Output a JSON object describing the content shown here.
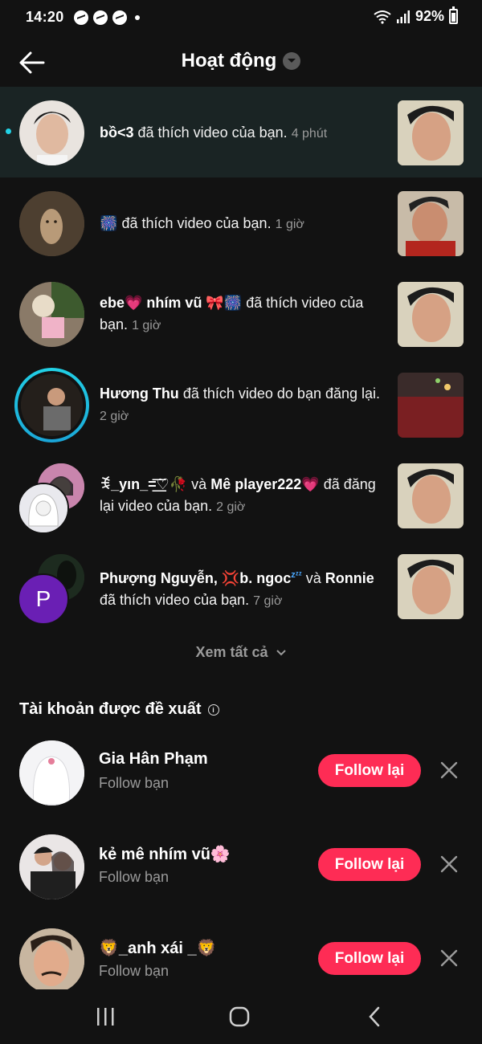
{
  "status_bar": {
    "time": "14:20",
    "battery": "92%"
  },
  "header": {
    "title": "Hoạt động"
  },
  "activities": [
    {
      "name": "bồ<3",
      "action": "đã thích video của bạn.",
      "time": "4 phút",
      "unread": true
    },
    {
      "name": "🎆",
      "action": "đã thích video của bạn.",
      "time": "1 giờ"
    },
    {
      "name": "ebe💗 nhím vũ 🎀🎆",
      "action": "đã thích video của bạn.",
      "time": "1 giờ"
    },
    {
      "name": "Hương Thu",
      "action": "đã thích video do bạn đăng lại.",
      "time": "2 giờ"
    },
    {
      "name": "ꉂ_yın_=͟͟͞♡🥀",
      "joiner": "và",
      "name2": "Mê player222💗",
      "action": "đã đăng lại video của bạn.",
      "time": "2 giờ"
    },
    {
      "name": "Phượng Nguyễn, 💢b. ngoc",
      "joiner": "và",
      "name2": "Ronnie",
      "action": "đã thích video của bạn.",
      "time": "7 giờ",
      "avatar_letter": "P"
    }
  ],
  "see_all": "Xem tất cả",
  "suggested": {
    "title": "Tài khoản được đề xuất",
    "items": [
      {
        "name": "Gia Hân Phạm",
        "subtitle": "Follow bạn",
        "button": "Follow lại"
      },
      {
        "name": "kẻ mê nhím vũ🌸",
        "subtitle": "Follow bạn",
        "button": "Follow lại"
      },
      {
        "name": "🦁_anh xái _🦁",
        "subtitle": "Follow bạn",
        "button": "Follow lại"
      }
    ]
  },
  "colors": {
    "accent": "#fe2c55",
    "unread_dot": "#22d3e6",
    "background": "#121212"
  }
}
